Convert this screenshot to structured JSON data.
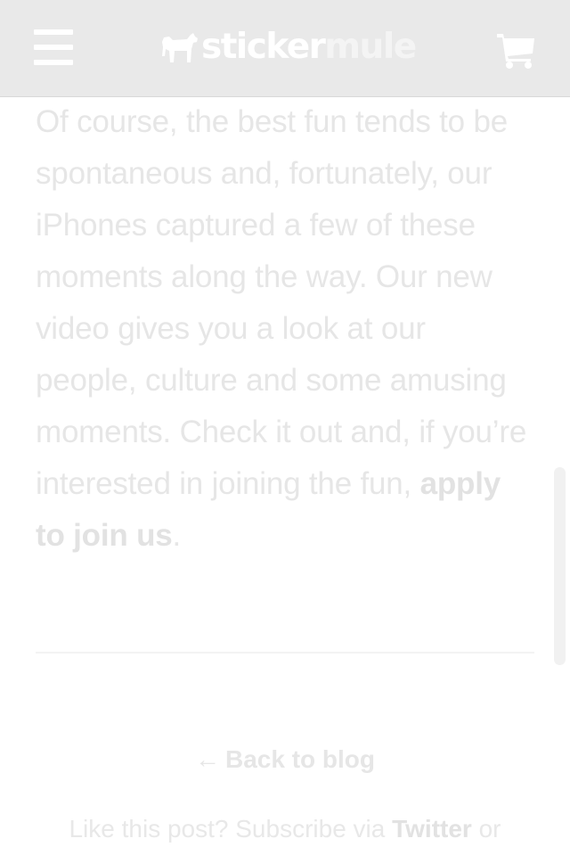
{
  "header": {
    "logo_part1": "sticker",
    "logo_part2": "mule",
    "menu_icon": "hamburger-icon",
    "cart_icon": "cart-icon"
  },
  "article": {
    "body_text": "Of course, the best fun tends to be spontaneous and, fortunately, our iPhones captured a few of these moments along the way. Our new video gives you a look at our people, culture and some amusing moments. Check it out and, if you’re interested in joining the fun, ",
    "link_label": "apply to join us",
    "end_punct": "."
  },
  "footer": {
    "back_arrow": "←",
    "back_label": "Back to blog",
    "subscribe_prefix": "Like this post? Subscribe via ",
    "twitter_label": "Twitter",
    "subscribe_suffix": " or"
  },
  "colors": {
    "header_bg": "#e9e9e9",
    "text": "#e6e6e6"
  }
}
